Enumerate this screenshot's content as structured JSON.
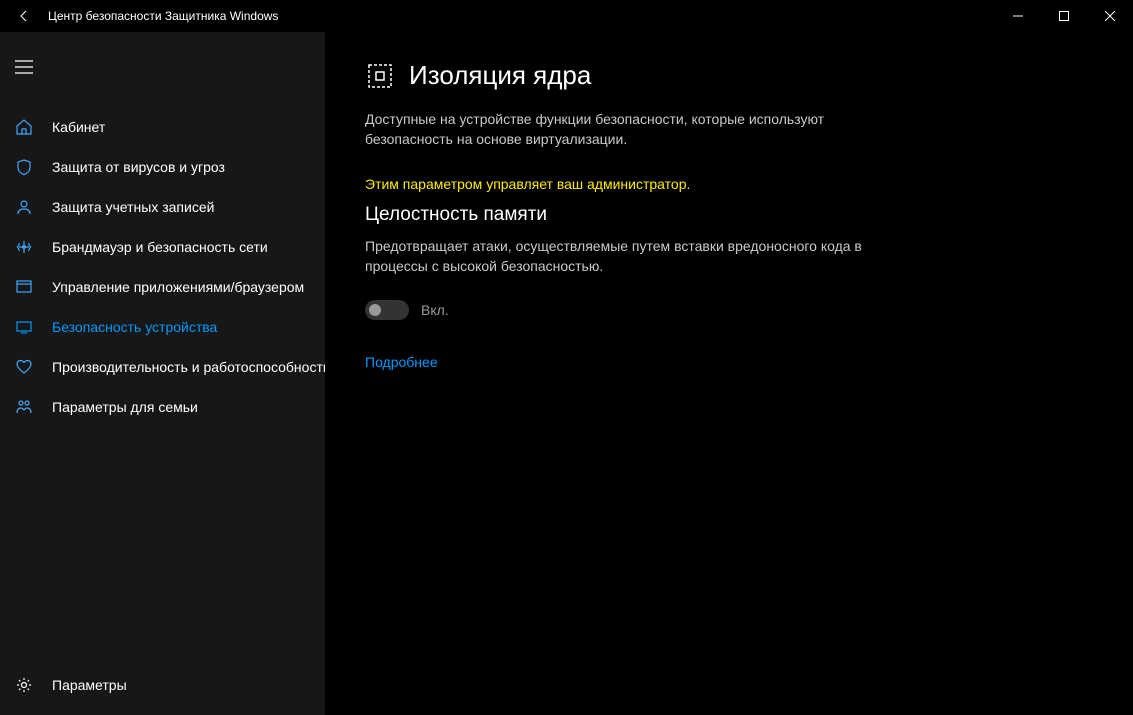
{
  "window": {
    "title": "Центр безопасности Защитника Windows"
  },
  "sidebar": {
    "items": [
      {
        "label": "Кабинет"
      },
      {
        "label": "Защита от вирусов и угроз"
      },
      {
        "label": "Защита учетных записей"
      },
      {
        "label": "Брандмауэр и безопасность сети"
      },
      {
        "label": "Управление приложениями/браузером"
      },
      {
        "label": "Безопасность устройства"
      },
      {
        "label": "Производительность и работоспособность устройства"
      },
      {
        "label": "Параметры для семьи"
      }
    ],
    "settings_label": "Параметры"
  },
  "main": {
    "title": "Изоляция ядра",
    "description": "Доступные на устройстве функции безопасности, которые используют безопасность на основе виртуализации.",
    "admin_notice": "Этим параметром управляет ваш администратор.",
    "memory_integrity": {
      "heading": "Целостность памяти",
      "description": "Предотвращает атаки, осуществляемые путем вставки вредоносного кода в процессы с высокой безопасностью.",
      "toggle_label": "Вкл."
    },
    "learn_more": "Подробнее"
  }
}
